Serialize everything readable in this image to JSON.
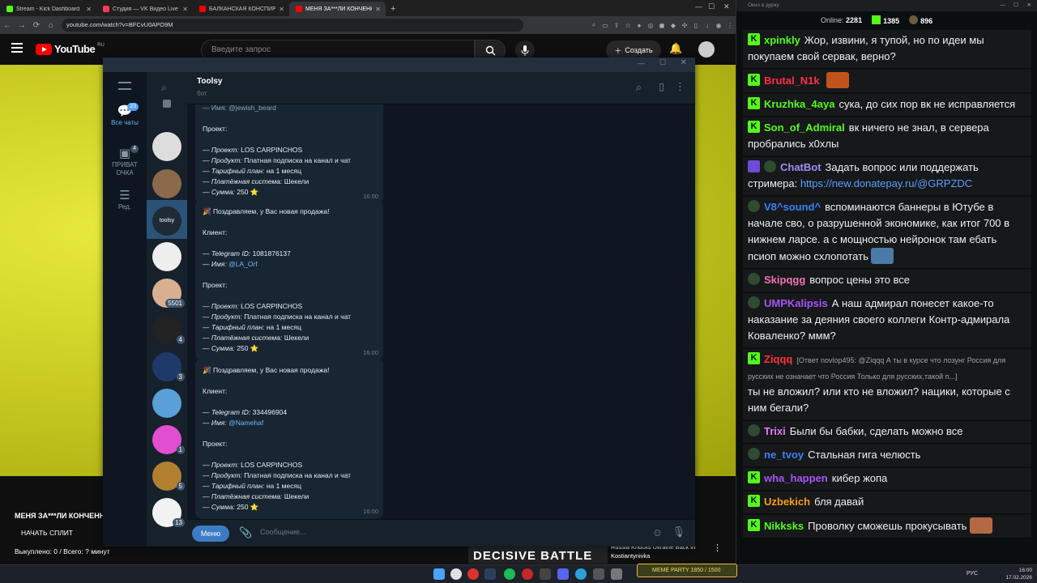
{
  "browser": {
    "tabs": [
      {
        "title": "Stream - Kick Dashboard",
        "color": "#53fc18"
      },
      {
        "title": "Студия — VK Видео Live",
        "color": "#ff3b5c"
      },
      {
        "title": "БАЛКАНСКАЯ КОНСПИРОЛОГИ…",
        "color": "#ff0000"
      },
      {
        "title": "МЕНЯ ЗА***ЛИ КОНЧЕННЫЕ…",
        "color": "#ff0000"
      }
    ],
    "url": "youtube.com/watch?v=BFCvU0APO9M"
  },
  "youtube": {
    "logo": "YouTube",
    "region": "RU",
    "search_placeholder": "Введите запрос",
    "create_label": "Создать",
    "video_title": "МЕНЯ ЗА***ЛИ КОНЧЕННЫ",
    "split_label": "НАЧАТЬ СПЛИТ",
    "bought_label": "Выкуплено: 0 / Всего: ? минут",
    "rec_banner": "DECISIVE BATTLE",
    "rec_title": "Russia Knocks Ukraine Back in Kostiantynivka"
  },
  "telegram": {
    "folders": [
      {
        "label": "Все чаты",
        "badge": "23",
        "active": true
      },
      {
        "label": "ПРИВАТ ОЧКА",
        "badge": "4",
        "active": false
      },
      {
        "label": "Ред.",
        "badge": "",
        "active": false
      }
    ],
    "chat_badges": [
      "",
      "",
      "",
      "",
      "",
      "5501",
      "4",
      "3",
      "",
      "1",
      "5",
      "13"
    ],
    "chat_logo": "toolsy",
    "chat_name": "Toolsy",
    "chat_status": "бот",
    "messages": [
      {
        "header": "",
        "top_name": "— Имя: @jewish_beard",
        "project_label": "Проект:",
        "project": "LOS CARPINCHOS",
        "product": "Платная подписка на канал и чат",
        "plan": "на 1 месяц",
        "payment": "Шекели",
        "sum": "250 ⭐",
        "time": "16:00"
      },
      {
        "header": "🎉 Поздравляем, у Вас новая продажа!",
        "client_label": "Клиент:",
        "tg_id": "1081876137",
        "name": "@LA_Orf",
        "project_label": "Проект:",
        "project": "LOS CARPINCHOS",
        "product": "Платная подписка на канал и чат",
        "plan": "на 1 месяц",
        "payment": "Шекели",
        "sum": "250 ⭐",
        "time": "16:00"
      },
      {
        "header": "🎉 Поздравляем, у Вас новая продажа!",
        "client_label": "Клиент:",
        "tg_id": "334496904",
        "name": "@Namehaf",
        "project_label": "Проект:",
        "project": "LOS CARPINCHOS",
        "product": "Платная подписка на канал и чат",
        "plan": "на 1 месяц",
        "payment": "Шекели",
        "sum": "250 ⭐",
        "time": "16:00"
      }
    ],
    "labels": {
      "tg_id": "Telegram ID:",
      "name": "Имя:",
      "project": "Проект:",
      "product": "Продукт:",
      "plan": "Тарифный план:",
      "payment": "Платёжная система:",
      "sum": "Сумма:"
    },
    "menu_button": "Меню",
    "input_placeholder": "Сообщение..."
  },
  "kick": {
    "window_title": "Окно в дурку",
    "online_label": "Online:",
    "online": "2281",
    "kick_count": "1385",
    "other_count": "896",
    "messages": [
      {
        "user": "xpinkly",
        "color": "#53fc18",
        "badge": "k",
        "text": "Жор, извини, я тупой, но по идеи мы покупаем свой сервак, верно?"
      },
      {
        "user": "Brutal_N1k",
        "color": "#ff3040",
        "badge": "k",
        "text": "",
        "emote": true
      },
      {
        "user": "Kruzhka_4aya",
        "color": "#53fc18",
        "badge": "k",
        "text": "сука, до сих пор вк не исправляется"
      },
      {
        "user": "Son_of_Admiral",
        "color": "#53fc18",
        "badge": "k",
        "text": "вк ничего не знал, в сервера пробрались х0хлы"
      },
      {
        "user": "ChatBot",
        "color": "#a78bfa",
        "badge": "bot",
        "text": "Задать вопрос или поддержать стримера:",
        "link": "https://new.donatepay.ru/@GRPZDC"
      },
      {
        "user": "V8^sound^",
        "color": "#3b82f6",
        "badge": "sub",
        "text": "вспоминаются баннеры в Ютубе в начале сво, о разрушенной экономике, как итог 700 в нижнем ларсе. а с мощностью нейронок там ебать псиоп можно схлопотать",
        "emote": true
      },
      {
        "user": "Skipqgg",
        "color": "#f472b6",
        "badge": "sub",
        "text": "вопрос цены это все"
      },
      {
        "user": "UMPKalipsis",
        "color": "#a855f7",
        "badge": "sub",
        "text": "А наш адмирал понесет какое-то наказание за деяния своего коллеги Контр-адмирала Коваленко? ммм?"
      },
      {
        "user": "Ziqqq",
        "color": "#ff3040",
        "badge": "k",
        "reply": "[Ответ noviop495: @Ziqqq А ты в курсе что лозунг Россия для русских не означает что Россия Только для русских,такой п...]",
        "text": "ты не вложил? или кто не вложил? нацики, которые с ним бегали?"
      },
      {
        "user": "Trixi",
        "color": "#e879f9",
        "badge": "sub",
        "text": "Были бы бабки, сделать можно все"
      },
      {
        "user": "ne_tvoy",
        "color": "#3b82f6",
        "badge": "sub",
        "text": "Стальная гига челюсть"
      },
      {
        "user": "wha_happen",
        "color": "#a855f7",
        "badge": "k",
        "text": "кибер жопа"
      },
      {
        "user": "Uzbekich",
        "color": "#f59e0b",
        "badge": "k",
        "text": "бля давай"
      },
      {
        "user": "Nikksks",
        "color": "#53fc18",
        "badge": "k",
        "text": "Проволку сможешь прокусывать",
        "emote": true
      }
    ]
  },
  "taskbar": {
    "lang": "РУС",
    "time": "16:00",
    "date": "17.02.2026",
    "overlay": "MEME PARTY 1850 / 1500"
  }
}
